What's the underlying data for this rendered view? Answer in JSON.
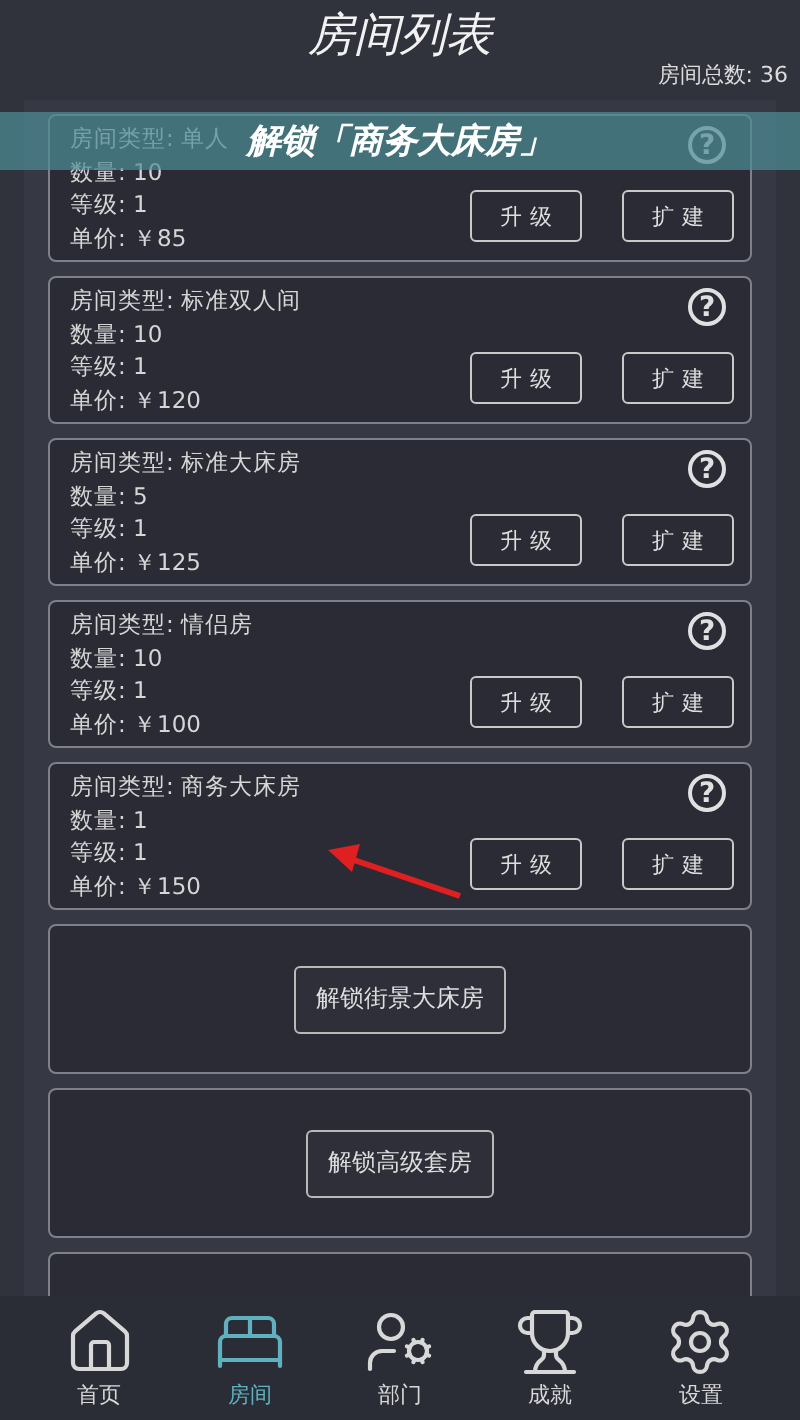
{
  "header": {
    "title": "房间列表",
    "room_total": "房间总数: 36"
  },
  "toast": {
    "text": "解锁「商务大床房」"
  },
  "rooms": [
    {
      "type": "房间类型: 单人",
      "count": "数量: 10",
      "level": "等级: 1",
      "price": "单价: ￥85",
      "buttons": [
        "升级",
        "扩建"
      ],
      "help": "?"
    },
    {
      "type": "房间类型: 标准双人间",
      "count": "数量: 10",
      "level": "等级: 1",
      "price": "单价: ￥120",
      "buttons": [
        "升级",
        "扩建"
      ],
      "help": "?"
    },
    {
      "type": "房间类型: 标准大床房",
      "count": "数量: 5",
      "level": "等级: 1",
      "price": "单价: ￥125",
      "buttons": [
        "升级",
        "扩建"
      ],
      "help": "?"
    },
    {
      "type": "房间类型: 情侣房",
      "count": "数量: 10",
      "level": "等级: 1",
      "price": "单价: ￥100",
      "buttons": [
        "升级",
        "扩建"
      ],
      "help": "?"
    },
    {
      "type": "房间类型: 商务大床房",
      "count": "数量: 1",
      "level": "等级: 1",
      "price": "单价: ￥150",
      "buttons": [
        "升级",
        "扩建"
      ],
      "help": "?"
    }
  ],
  "locked_rooms": [
    {
      "button": "解锁街景大床房"
    },
    {
      "button": "解锁高级套房"
    }
  ],
  "tab_bar": [
    {
      "kind": "home",
      "label": "首页",
      "selected": false
    },
    {
      "kind": "bed",
      "label": "房间",
      "selected": true
    },
    {
      "kind": "staff",
      "label": "部门",
      "selected": false
    },
    {
      "kind": "trophy",
      "label": "成就",
      "selected": false
    },
    {
      "kind": "settings",
      "label": "设置",
      "selected": false
    }
  ]
}
